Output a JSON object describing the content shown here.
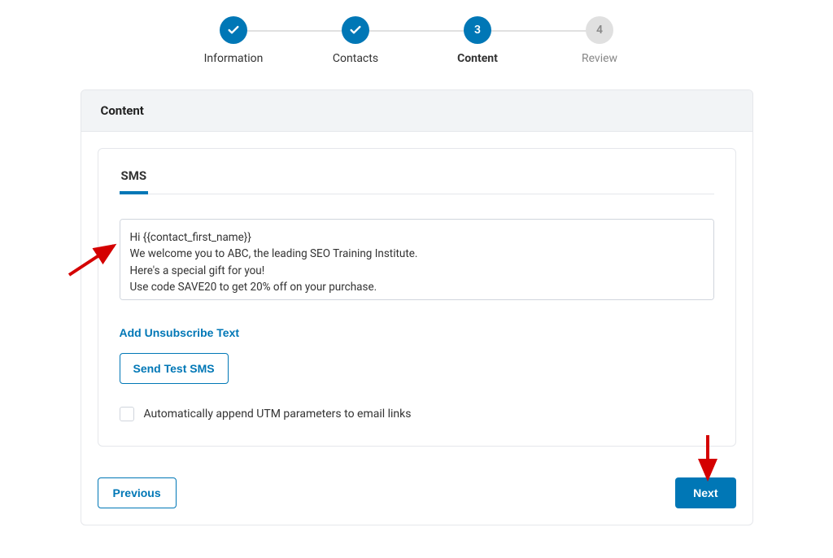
{
  "stepper": {
    "steps": [
      {
        "label": "Information",
        "state": "done",
        "text": ""
      },
      {
        "label": "Contacts",
        "state": "done",
        "text": ""
      },
      {
        "label": "Content",
        "state": "active",
        "text": "3"
      },
      {
        "label": "Review",
        "state": "pending",
        "text": "4"
      }
    ]
  },
  "panel": {
    "title": "Content"
  },
  "sms": {
    "tab_label": "SMS",
    "message": "Hi {{contact_first_name}}\nWe welcome you to ABC, the leading SEO Training Institute.\nHere's a special gift for you!\nUse code SAVE20 to get 20% off on your purchase.",
    "unsubscribe_link": "Add Unsubscribe Text",
    "send_test_button": "Send Test SMS",
    "utm_checkbox_label": "Automatically append UTM parameters to email links"
  },
  "footer": {
    "previous": "Previous",
    "next": "Next"
  }
}
